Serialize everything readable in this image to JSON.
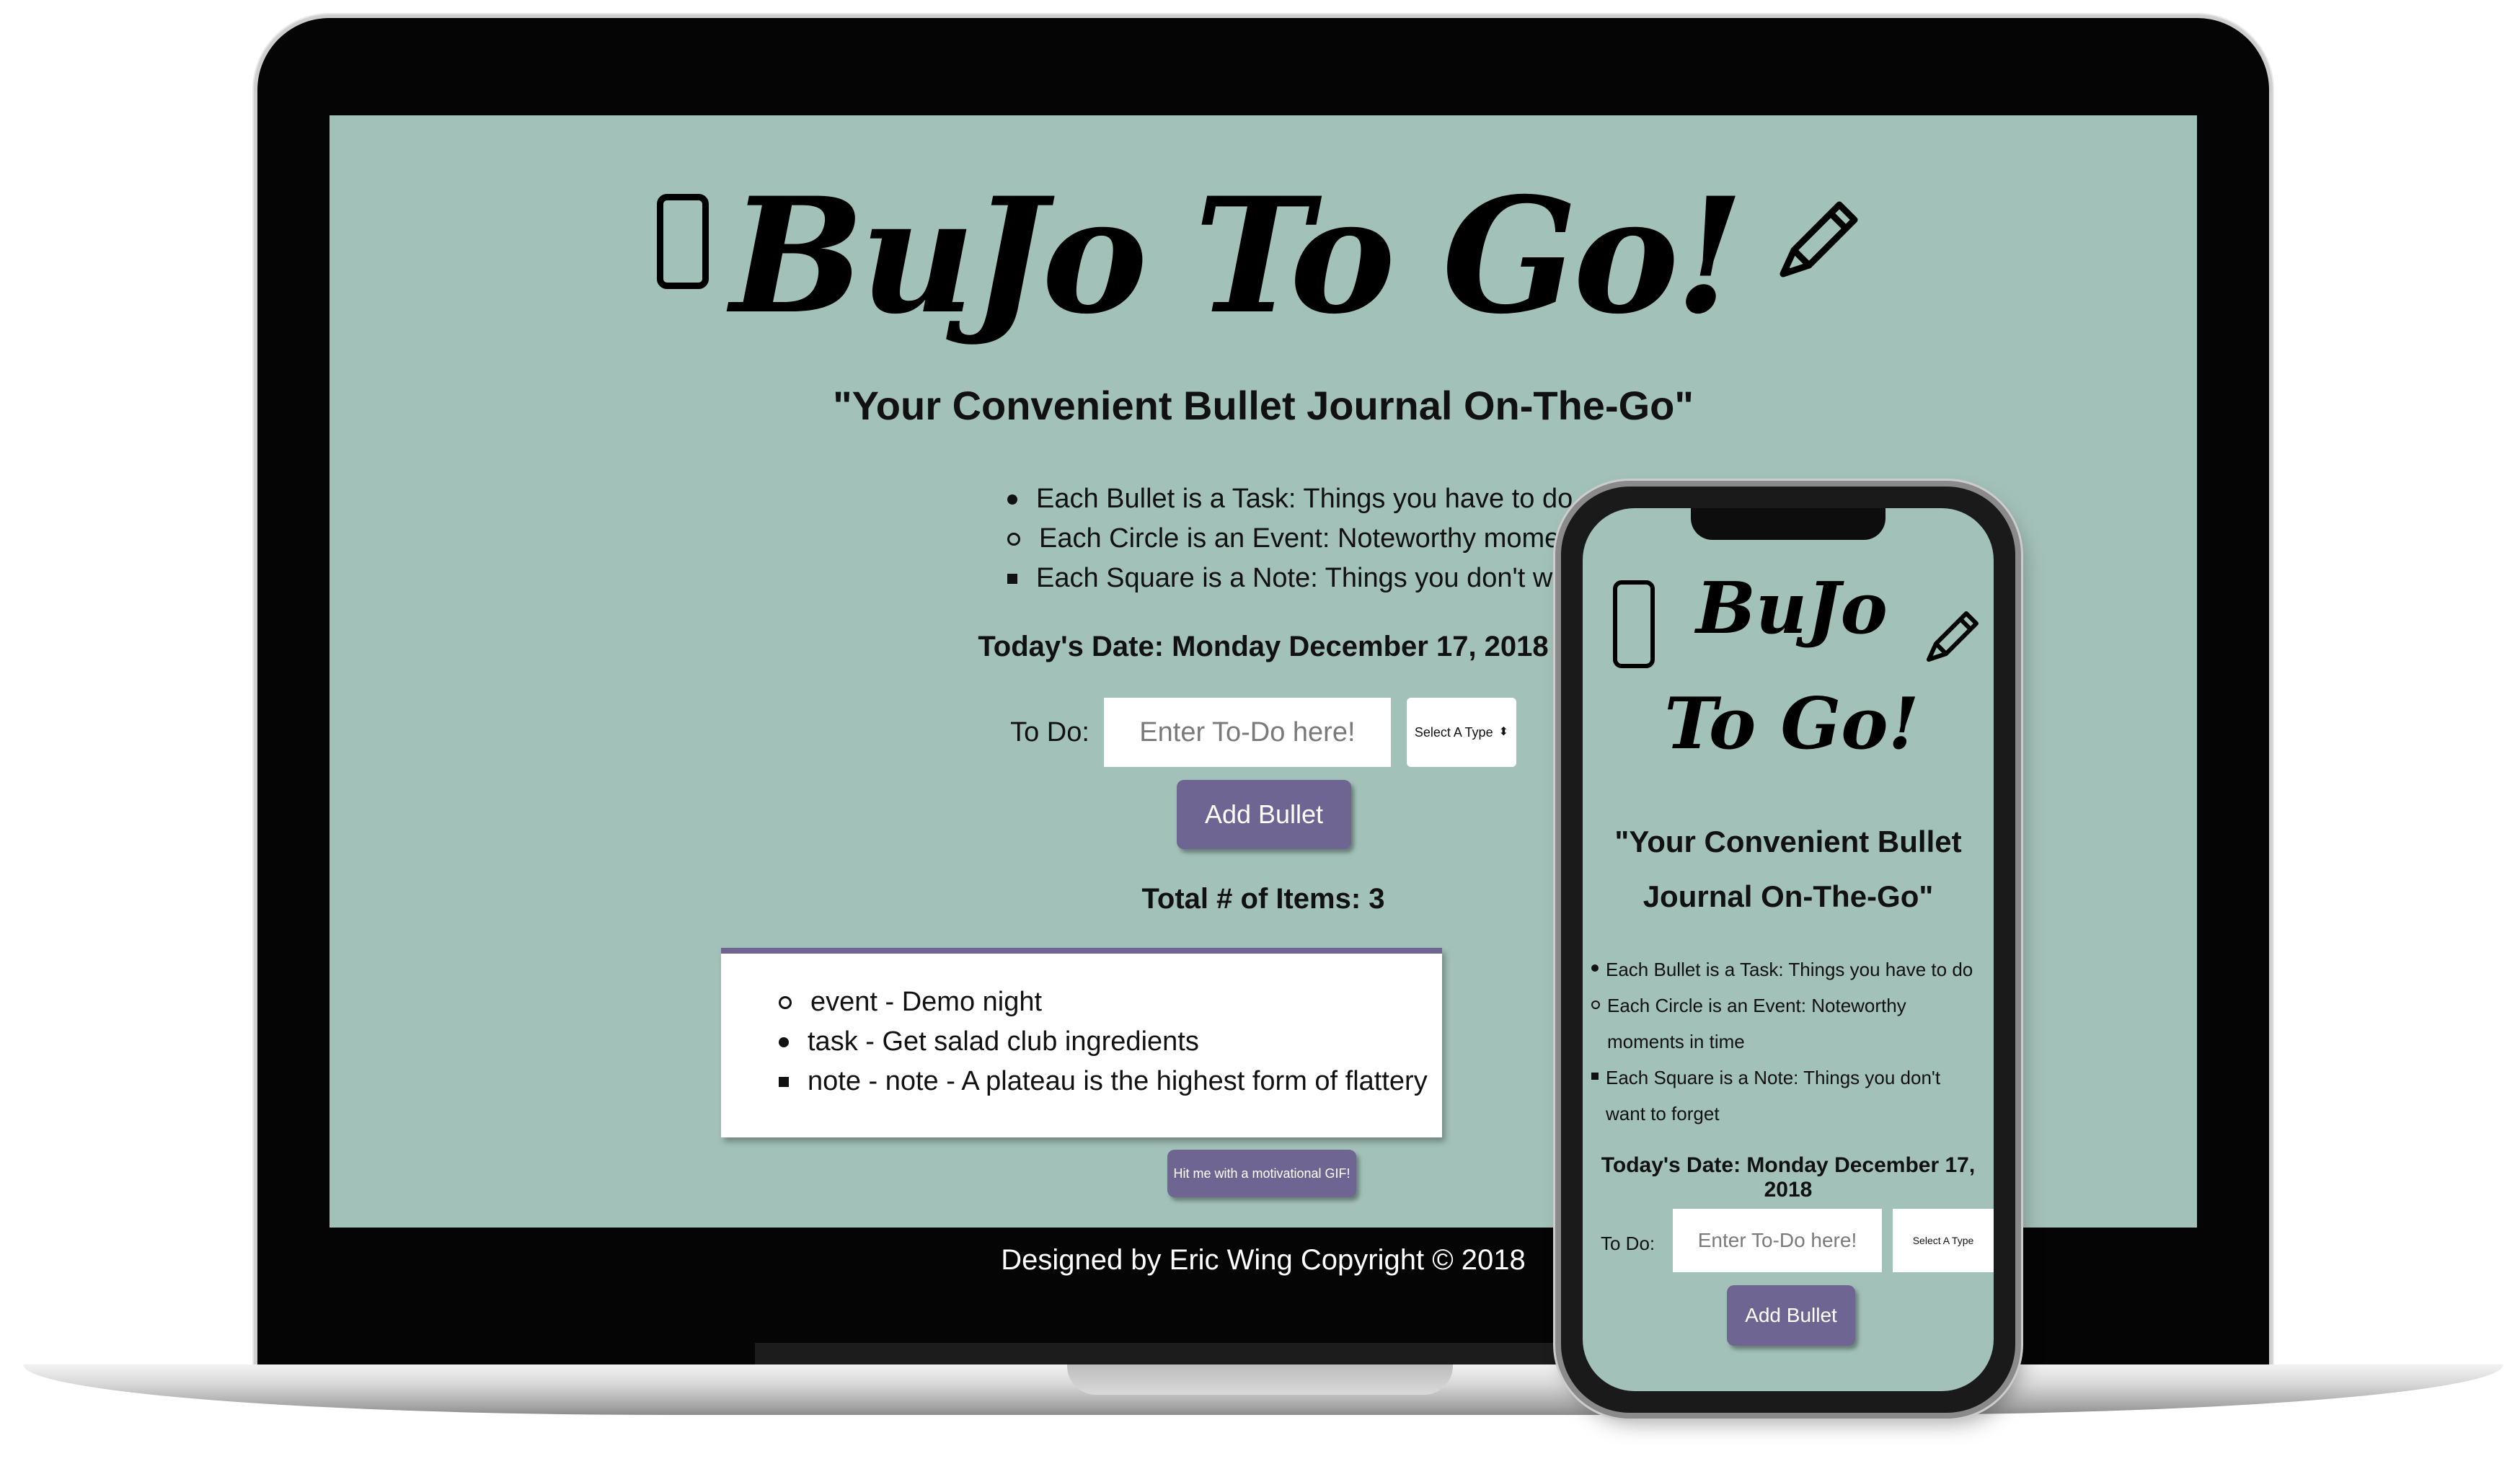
{
  "app": {
    "brand": "BuJo To Go!",
    "tagline": "\"Your Convenient Bullet Journal On-The-Go\"",
    "legend": [
      {
        "marker": "disc",
        "text": "Each Bullet is a Task: Things you have to do"
      },
      {
        "marker": "circle",
        "text": "Each Circle is an Event: Noteworthy moments in time"
      },
      {
        "marker": "square",
        "text": "Each Square is a Note: Things you don't want to forget"
      }
    ],
    "date_line": "Today's Date: Monday December 17, 2018",
    "todo_label": "To Do:",
    "todo_placeholder": "Enter To-Do here!",
    "type_select": "Select A Type",
    "add_button": "Add Bullet",
    "total_items": "Total # of Items: 3",
    "items": [
      {
        "marker": "circle",
        "text": "event - Demo night"
      },
      {
        "marker": "disc",
        "text": "task - Get salad club ingredients"
      },
      {
        "marker": "square",
        "text": "note - note - A plateau is the highest form of flattery"
      }
    ],
    "gif_button": "Hit me with a motivational GIF!",
    "footer": "Designed by Eric Wing Copyright © 2018"
  },
  "colors": {
    "page_background": "#a2c1b8",
    "button": "#6f6592",
    "text": "#111111"
  }
}
